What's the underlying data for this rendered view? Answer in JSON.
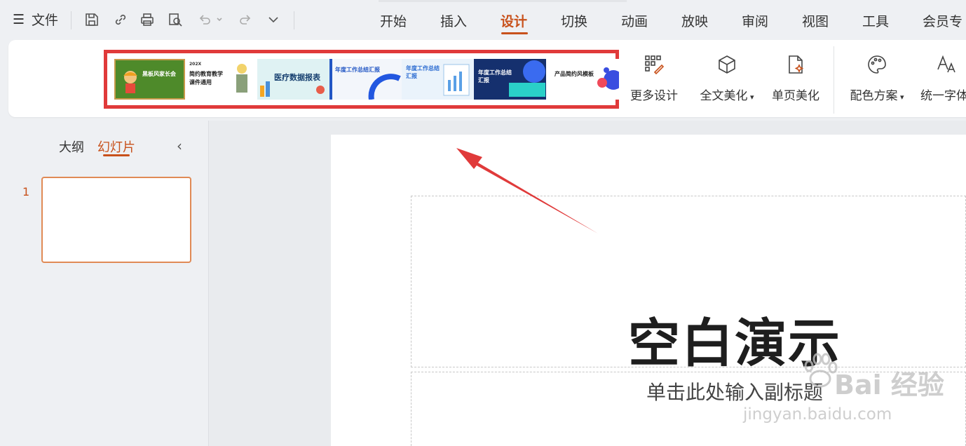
{
  "menu": {
    "hamburger": "☰",
    "file_label": "文件",
    "tabs": [
      "开始",
      "插入",
      "设计",
      "切换",
      "动画",
      "放映",
      "审阅",
      "视图",
      "工具",
      "会员专"
    ],
    "active_tab": "设计"
  },
  "gallery": {
    "templates": [
      {
        "title": "黑板风家长会",
        "bg": "#4e8a2a"
      },
      {
        "title": "简约教育教学课件通用",
        "tag": "202X",
        "bg": "#ffffff"
      },
      {
        "title": "医疗数据报表",
        "bg": "#dff2f3"
      },
      {
        "title": "年度工作总结汇报",
        "bg": "#f3f6fb"
      },
      {
        "title": "年度工作总结汇报",
        "bg": "#eaf3fb"
      },
      {
        "title": "年度工作总结汇报",
        "bg": "#15306e"
      },
      {
        "title": "产品简约风模板",
        "bg": "#ffffff"
      }
    ]
  },
  "ribbon": {
    "more_design": "更多设计",
    "beautify_all": "全文美化",
    "beautify_page": "单页美化",
    "color_scheme": "配色方案",
    "unify_font": "统一字体"
  },
  "left_pane": {
    "outline_tab": "大纲",
    "slides_tab": "幻灯片",
    "collapse": "‹",
    "slide_number": "1"
  },
  "slide": {
    "title": "空白演示",
    "subtitle": "单击此处输入副标题"
  },
  "watermark": {
    "brand": "Bai 经验",
    "url": "jingyan.baidu.com"
  },
  "colors": {
    "accent": "#c8511b",
    "highlight_box": "#e03a3a",
    "arrow": "#e03a3a"
  }
}
